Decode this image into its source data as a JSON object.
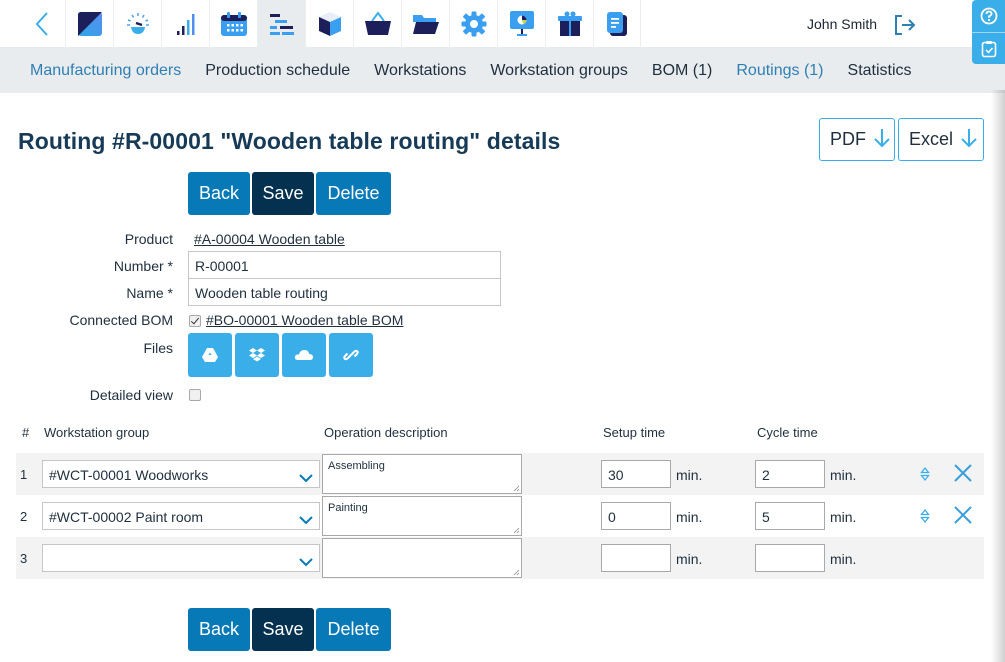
{
  "topbar": {
    "back_icon": "chevron-left-icon",
    "apps": [
      {
        "name": "dashboard-app-icon",
        "active": false
      },
      {
        "name": "speedometer-app-icon",
        "active": false
      },
      {
        "name": "signal-bars-app-icon",
        "active": false
      },
      {
        "name": "calendar-app-icon",
        "active": false
      },
      {
        "name": "gantt-app-icon",
        "active": true
      },
      {
        "name": "cube-app-icon",
        "active": false
      },
      {
        "name": "basket-app-icon",
        "active": false
      },
      {
        "name": "folder-app-icon",
        "active": false
      },
      {
        "name": "gear-app-icon",
        "active": false
      },
      {
        "name": "presentation-app-icon",
        "active": false
      },
      {
        "name": "gift-app-icon",
        "active": false
      },
      {
        "name": "document-app-icon",
        "active": false
      }
    ],
    "user_name": "John Smith",
    "logout_icon": "logout-icon"
  },
  "float_tabs": [
    "help-icon",
    "clipboard-check-icon"
  ],
  "subnav": {
    "items": [
      {
        "label": "Manufacturing orders",
        "link": true
      },
      {
        "label": "Production schedule",
        "link": false
      },
      {
        "label": "Workstations",
        "link": false
      },
      {
        "label": "Workstation groups",
        "link": false
      },
      {
        "label": "BOM (1)",
        "link": false
      },
      {
        "label": "Routings (1)",
        "link": true
      },
      {
        "label": "Statistics",
        "link": false
      }
    ]
  },
  "page": {
    "title": "Routing #R-00001 \"Wooden table routing\" details",
    "export_pdf": "PDF",
    "export_excel": "Excel",
    "buttons": {
      "back": "Back",
      "save": "Save",
      "delete": "Delete"
    }
  },
  "form": {
    "product_label": "Product",
    "product_value": "#A-00004 Wooden table",
    "number_label": "Number *",
    "number_value": "R-00001",
    "name_label": "Name *",
    "name_value": "Wooden table routing",
    "connected_bom_label": "Connected BOM",
    "connected_bom_checked": true,
    "connected_bom_value": "#BO-00001 Wooden table BOM",
    "files_label": "Files",
    "file_buttons": [
      "google-drive-icon",
      "dropbox-icon",
      "onedrive-cloud-icon",
      "link-icon"
    ],
    "detailed_view_label": "Detailed view",
    "detailed_view_checked": false
  },
  "table": {
    "headers": {
      "num": "#",
      "workstation_group": "Workstation group",
      "operation_description": "Operation description",
      "setup_time": "Setup time",
      "cycle_time": "Cycle time"
    },
    "unit": "min.",
    "rows": [
      {
        "num": "1",
        "workstation_group": "#WCT-00001 Woodworks",
        "operation_description": "Assembling",
        "setup_time": "30",
        "cycle_time": "2"
      },
      {
        "num": "2",
        "workstation_group": "#WCT-00002 Paint room",
        "operation_description": "Painting",
        "setup_time": "0",
        "cycle_time": "5"
      },
      {
        "num": "3",
        "workstation_group": "",
        "operation_description": "",
        "setup_time": "",
        "cycle_time": ""
      }
    ]
  },
  "colors": {
    "primary": "#0879b7",
    "dark": "#04314f",
    "accent": "#3aaee8",
    "link": "#2f7fb2",
    "subnav_bg": "#e9ecef"
  }
}
